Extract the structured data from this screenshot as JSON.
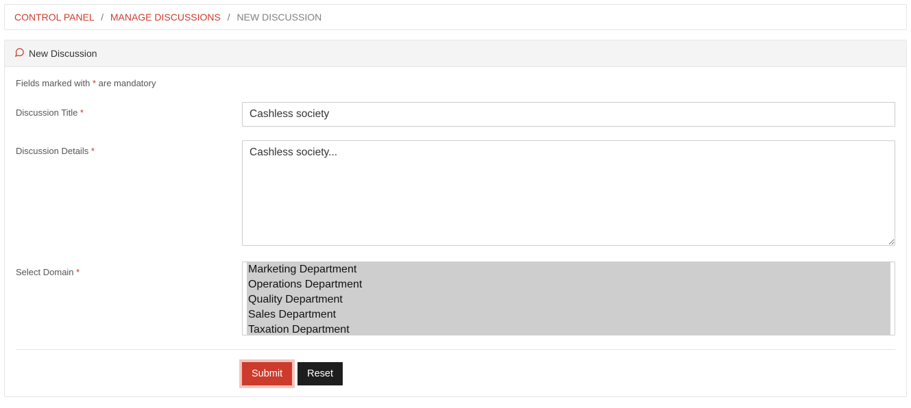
{
  "breadcrumbs": {
    "control_panel": "CONTROL PANEL",
    "manage_discussions": "MANAGE DISCUSSIONS",
    "current": "NEW DISCUSSION",
    "sep": "/"
  },
  "panel": {
    "title": "New Discussion"
  },
  "mandatory": {
    "prefix": "Fields marked with ",
    "ast": "*",
    "suffix": " are mandatory"
  },
  "fields": {
    "title_label": "Discussion Title ",
    "title_value": "Cashless society",
    "details_label": "Discussion Details ",
    "details_value": "Cashless society...",
    "domain_label": "Select Domain "
  },
  "domain_options": [
    "Marketing Department",
    "Operations Department",
    "Quality Department",
    "Sales Department",
    "Taxation Department"
  ],
  "buttons": {
    "submit": "Submit",
    "reset": "Reset"
  },
  "asterisk": "*"
}
